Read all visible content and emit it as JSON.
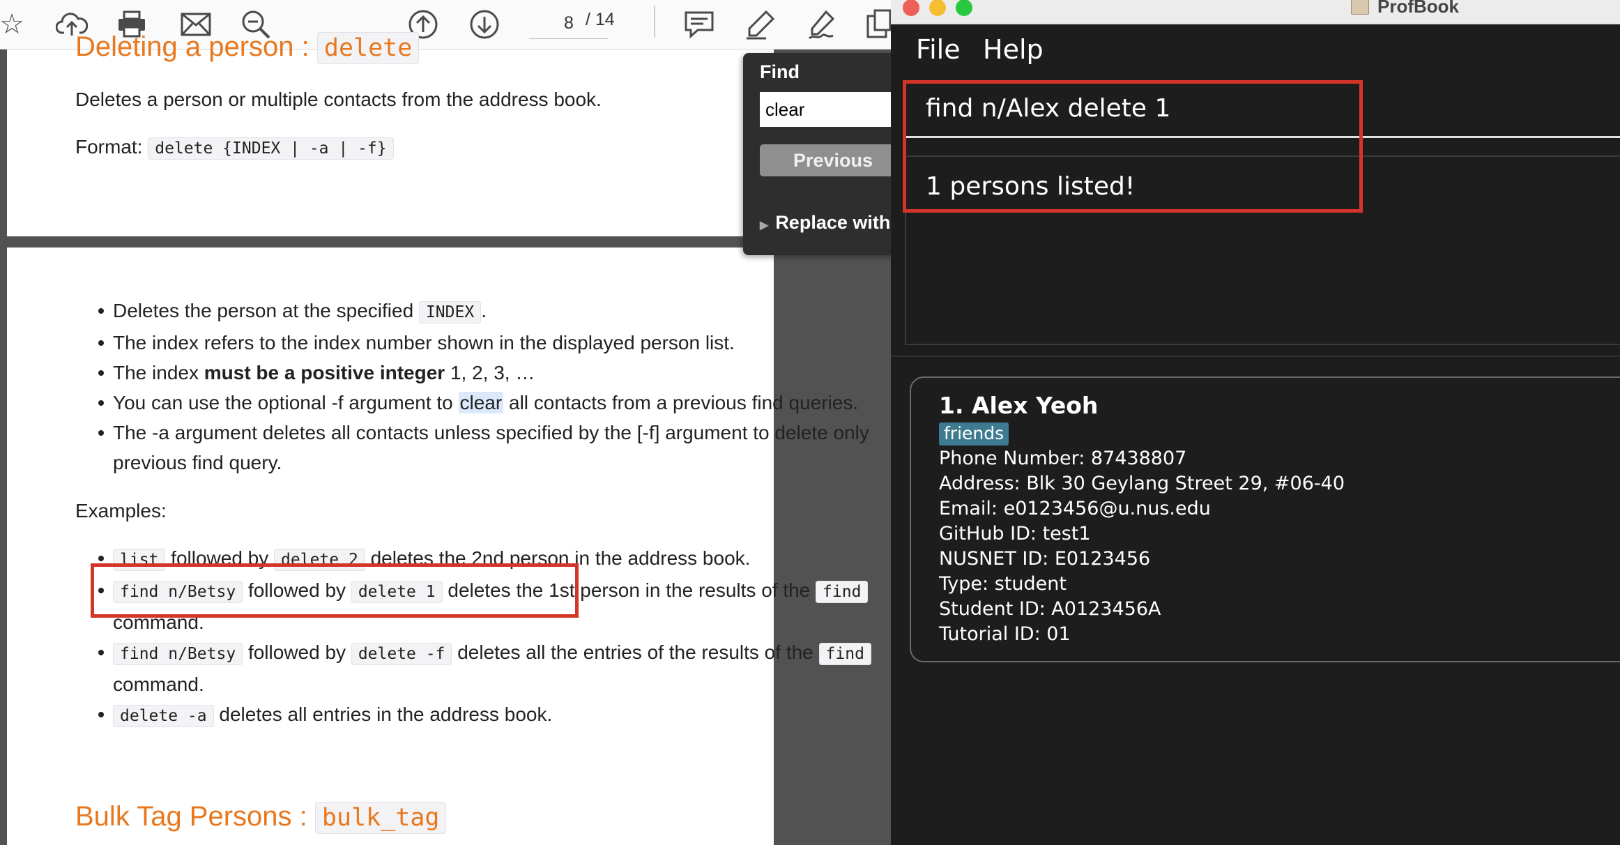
{
  "toolbar": {
    "page_number": "8",
    "page_total": "/ 14"
  },
  "doc": {
    "delete_heading_text": "Deleting a person : ",
    "delete_heading_code": "delete",
    "delete_desc": "Deletes a person or multiple contacts from the address book.",
    "format_label": "Format:",
    "format_code": "delete {INDEX | -a | -f}",
    "bullets": {
      "b1_pre": "Deletes the person at the specified ",
      "b1_code": "INDEX",
      "b1_post": ".",
      "b2": "The index refers to the index number shown in the displayed person list.",
      "b3_pre": "The index ",
      "b3_bold": "must be a positive integer",
      "b3_post": " 1, 2, 3, …",
      "b4_pre": "You can use the optional -f argument to ",
      "b4_hl": "clear",
      "b4_post": " all contacts from a previous find queries.",
      "b5_line1": "The -a argument deletes all contacts unless specified by the [-f] argument to delete only",
      "b5_line2": "previous find query."
    },
    "examples_label": "Examples:",
    "examples": {
      "e1_code1": "list",
      "e1_mid": " followed by ",
      "e1_code2": "delete 2",
      "e1_post": " deletes the 2nd person in the address book.",
      "e2_code1": "find n/Betsy",
      "e2_mid": " followed by ",
      "e2_code2": "delete 1",
      "e2_post": " deletes the 1st person in the results of the ",
      "e2_code3": "find",
      "e2_line2": "command.",
      "e3_code1": "find n/Betsy",
      "e3_mid": " followed by ",
      "e3_code2": "delete -f",
      "e3_post": " deletes all the entries of the results of the ",
      "e3_code3": "find",
      "e3_line2": "command.",
      "e4_code": "delete -a",
      "e4_post": " deletes all entries in the address book."
    },
    "bulk_heading_text": "Bulk Tag Persons : ",
    "bulk_heading_code": "bulk_tag"
  },
  "find_panel": {
    "title": "Find",
    "query": "clear",
    "previous_label": "Previous",
    "replace_label": "Replace with"
  },
  "app": {
    "window_title": "ProfBook",
    "menu": {
      "file": "File",
      "help": "Help"
    },
    "command_value": "find n/Alex delete 1",
    "result_text": "1 persons listed!",
    "person": {
      "name": "1.  Alex Yeoh",
      "tag": "friends",
      "phone": "Phone Number: 87438807",
      "address": "Address: Blk 30 Geylang Street 29, #06-40",
      "email": "Email: e0123456@u.nus.edu",
      "github": "GitHub ID: test1",
      "nusnet": "NUSNET ID: E0123456",
      "type": "Type: student",
      "student_id": "Student ID: A0123456A",
      "tutorial": "Tutorial ID: 01"
    }
  },
  "colors": {
    "highlight_box": "#d33628",
    "heading_orange": "#e8781e",
    "tag_bg": "#3e7b91",
    "app_bg": "#1d1d1d"
  }
}
